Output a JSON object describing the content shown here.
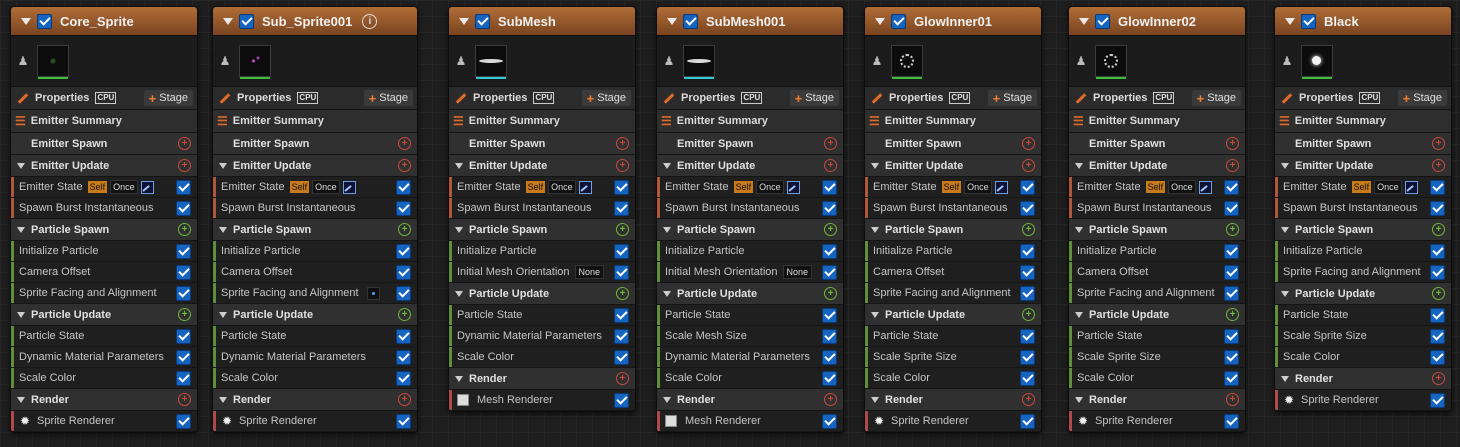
{
  "emitters": [
    {
      "name": "Core_Sprite",
      "warning": false,
      "thumb": "sprite dots",
      "props_label": "Properties",
      "cpu_label": "CPU",
      "stage_label": "Stage",
      "summary_label": "Emitter Summary",
      "sections": [
        {
          "title": "Emitter Spawn",
          "arrow": false,
          "add": "red",
          "kind": "emitter-mod",
          "modules": []
        },
        {
          "title": "Emitter Update",
          "arrow": true,
          "add": "red",
          "kind": "emitter-mod",
          "modules": [
            {
              "label": "Emitter State",
              "extra": "state",
              "self": "Self",
              "once": "Once"
            },
            {
              "label": "Spawn Burst Instantaneous"
            }
          ]
        },
        {
          "title": "Particle Spawn",
          "arrow": true,
          "add": "green",
          "kind": "spawn-mod",
          "modules": [
            {
              "label": "Initialize Particle"
            },
            {
              "label": "Camera Offset"
            },
            {
              "label": "Sprite Facing and Alignment"
            }
          ]
        },
        {
          "title": "Particle Update",
          "arrow": true,
          "add": "green",
          "kind": "update-mod",
          "modules": [
            {
              "label": "Particle State"
            },
            {
              "label": "Dynamic Material Parameters"
            },
            {
              "label": "Scale Color"
            }
          ]
        },
        {
          "title": "Render",
          "arrow": true,
          "add": "red",
          "kind": "render-mod",
          "modules": [
            {
              "label": "Sprite Renderer",
              "renderer": "sprite"
            }
          ]
        }
      ]
    },
    {
      "name": "Sub_Sprite001",
      "warning": true,
      "warning_icon": "i",
      "thumb": "sprite pink",
      "props_label": "Properties",
      "cpu_label": "CPU",
      "stage_label": "Stage",
      "summary_label": "Emitter Summary",
      "sections": [
        {
          "title": "Emitter Spawn",
          "arrow": false,
          "add": "red",
          "kind": "emitter-mod",
          "modules": []
        },
        {
          "title": "Emitter Update",
          "arrow": true,
          "add": "red",
          "kind": "emitter-mod",
          "modules": [
            {
              "label": "Emitter State",
              "extra": "state",
              "self": "Self",
              "once": "Once"
            },
            {
              "label": "Spawn Burst Instantaneous"
            }
          ]
        },
        {
          "title": "Particle Spawn",
          "arrow": true,
          "add": "green",
          "kind": "spawn-mod",
          "modules": [
            {
              "label": "Initialize Particle"
            },
            {
              "label": "Camera Offset"
            },
            {
              "label": "Sprite Facing and Alignment",
              "extra": "dot"
            }
          ]
        },
        {
          "title": "Particle Update",
          "arrow": true,
          "add": "green",
          "kind": "update-mod",
          "modules": [
            {
              "label": "Particle State"
            },
            {
              "label": "Dynamic Material Parameters"
            },
            {
              "label": "Scale Color"
            }
          ]
        },
        {
          "title": "Render",
          "arrow": true,
          "add": "red",
          "kind": "render-mod",
          "modules": [
            {
              "label": "Sprite Renderer",
              "renderer": "sprite"
            }
          ]
        }
      ]
    },
    {
      "name": "SubMesh",
      "warning": false,
      "thumb": "mesh",
      "props_label": "Properties",
      "cpu_label": "CPU",
      "stage_label": "Stage",
      "summary_label": "Emitter Summary",
      "sections": [
        {
          "title": "Emitter Spawn",
          "arrow": false,
          "add": "red",
          "kind": "emitter-mod",
          "modules": []
        },
        {
          "title": "Emitter Update",
          "arrow": true,
          "add": "red",
          "kind": "emitter-mod",
          "modules": [
            {
              "label": "Emitter State",
              "extra": "state",
              "self": "Self",
              "once": "Once"
            },
            {
              "label": "Spawn Burst Instantaneous"
            }
          ]
        },
        {
          "title": "Particle Spawn",
          "arrow": true,
          "add": "green",
          "kind": "spawn-mod",
          "modules": [
            {
              "label": "Initialize Particle"
            },
            {
              "label": "Initial Mesh Orientation",
              "extra": "none",
              "none": "None"
            }
          ]
        },
        {
          "title": "Particle Update",
          "arrow": true,
          "add": "green",
          "kind": "update-mod",
          "modules": [
            {
              "label": "Particle State"
            },
            {
              "label": "Dynamic Material Parameters"
            },
            {
              "label": "Scale Color"
            }
          ]
        },
        {
          "title": "Render",
          "arrow": true,
          "add": "red",
          "kind": "render-mod",
          "modules": [
            {
              "label": "Mesh Renderer",
              "renderer": "mesh"
            }
          ]
        }
      ]
    },
    {
      "name": "SubMesh001",
      "warning": false,
      "thumb": "mesh",
      "props_label": "Properties",
      "cpu_label": "CPU",
      "stage_label": "Stage",
      "summary_label": "Emitter Summary",
      "sections": [
        {
          "title": "Emitter Spawn",
          "arrow": false,
          "add": "red",
          "kind": "emitter-mod",
          "modules": []
        },
        {
          "title": "Emitter Update",
          "arrow": true,
          "add": "red",
          "kind": "emitter-mod",
          "modules": [
            {
              "label": "Emitter State",
              "extra": "state",
              "self": "Self",
              "once": "Once"
            },
            {
              "label": "Spawn Burst Instantaneous"
            }
          ]
        },
        {
          "title": "Particle Spawn",
          "arrow": true,
          "add": "green",
          "kind": "spawn-mod",
          "modules": [
            {
              "label": "Initialize Particle"
            },
            {
              "label": "Initial Mesh Orientation",
              "extra": "none",
              "none": "None"
            }
          ]
        },
        {
          "title": "Particle Update",
          "arrow": true,
          "add": "green",
          "kind": "update-mod",
          "modules": [
            {
              "label": "Particle State"
            },
            {
              "label": "Scale Mesh Size"
            },
            {
              "label": "Dynamic Material Parameters"
            },
            {
              "label": "Scale Color"
            }
          ]
        },
        {
          "title": "Render",
          "arrow": true,
          "add": "red",
          "kind": "render-mod",
          "modules": [
            {
              "label": "Mesh Renderer",
              "renderer": "mesh"
            }
          ]
        }
      ]
    },
    {
      "name": "GlowInner01",
      "warning": false,
      "thumb": "sprite ring",
      "props_label": "Properties",
      "cpu_label": "CPU",
      "stage_label": "Stage",
      "summary_label": "Emitter Summary",
      "sections": [
        {
          "title": "Emitter Spawn",
          "arrow": false,
          "add": "red",
          "kind": "emitter-mod",
          "modules": []
        },
        {
          "title": "Emitter Update",
          "arrow": true,
          "add": "red",
          "kind": "emitter-mod",
          "modules": [
            {
              "label": "Emitter State",
              "extra": "state",
              "self": "Self",
              "once": "Once"
            },
            {
              "label": "Spawn Burst Instantaneous"
            }
          ]
        },
        {
          "title": "Particle Spawn",
          "arrow": true,
          "add": "green",
          "kind": "spawn-mod",
          "modules": [
            {
              "label": "Initialize Particle"
            },
            {
              "label": "Camera Offset"
            },
            {
              "label": "Sprite Facing and Alignment"
            }
          ]
        },
        {
          "title": "Particle Update",
          "arrow": true,
          "add": "green",
          "kind": "update-mod",
          "modules": [
            {
              "label": "Particle State"
            },
            {
              "label": "Scale Sprite Size"
            },
            {
              "label": "Scale Color"
            }
          ]
        },
        {
          "title": "Render",
          "arrow": true,
          "add": "red",
          "kind": "render-mod",
          "modules": [
            {
              "label": "Sprite Renderer",
              "renderer": "sprite"
            }
          ]
        }
      ]
    },
    {
      "name": "GlowInner02",
      "warning": false,
      "thumb": "sprite ring",
      "props_label": "Properties",
      "cpu_label": "CPU",
      "stage_label": "Stage",
      "summary_label": "Emitter Summary",
      "sections": [
        {
          "title": "Emitter Spawn",
          "arrow": false,
          "add": "red",
          "kind": "emitter-mod",
          "modules": []
        },
        {
          "title": "Emitter Update",
          "arrow": true,
          "add": "red",
          "kind": "emitter-mod",
          "modules": [
            {
              "label": "Emitter State",
              "extra": "state",
              "self": "Self",
              "once": "Once"
            },
            {
              "label": "Spawn Burst Instantaneous"
            }
          ]
        },
        {
          "title": "Particle Spawn",
          "arrow": true,
          "add": "green",
          "kind": "spawn-mod",
          "modules": [
            {
              "label": "Initialize Particle"
            },
            {
              "label": "Camera Offset"
            },
            {
              "label": "Sprite Facing and Alignment"
            }
          ]
        },
        {
          "title": "Particle Update",
          "arrow": true,
          "add": "green",
          "kind": "update-mod",
          "modules": [
            {
              "label": "Particle State"
            },
            {
              "label": "Scale Sprite Size"
            },
            {
              "label": "Scale Color"
            }
          ]
        },
        {
          "title": "Render",
          "arrow": true,
          "add": "red",
          "kind": "render-mod",
          "modules": [
            {
              "label": "Sprite Renderer",
              "renderer": "sprite"
            }
          ]
        }
      ]
    },
    {
      "name": "Black",
      "warning": false,
      "thumb": "sprite dot",
      "props_label": "Properties",
      "cpu_label": "CPU",
      "stage_label": "Stage",
      "summary_label": "Emitter Summary",
      "sections": [
        {
          "title": "Emitter Spawn",
          "arrow": false,
          "add": "red",
          "kind": "emitter-mod",
          "modules": []
        },
        {
          "title": "Emitter Update",
          "arrow": true,
          "add": "red",
          "kind": "emitter-mod",
          "modules": [
            {
              "label": "Emitter State",
              "extra": "state",
              "self": "Self",
              "once": "Once"
            },
            {
              "label": "Spawn Burst Instantaneous"
            }
          ]
        },
        {
          "title": "Particle Spawn",
          "arrow": true,
          "add": "green",
          "kind": "spawn-mod",
          "modules": [
            {
              "label": "Initialize Particle"
            },
            {
              "label": "Sprite Facing and Alignment"
            }
          ]
        },
        {
          "title": "Particle Update",
          "arrow": true,
          "add": "green",
          "kind": "update-mod",
          "modules": [
            {
              "label": "Particle State"
            },
            {
              "label": "Scale Sprite Size"
            },
            {
              "label": "Scale Color"
            }
          ]
        },
        {
          "title": "Render",
          "arrow": true,
          "add": "red",
          "kind": "render-mod",
          "modules": [
            {
              "label": "Sprite Renderer",
              "renderer": "sprite"
            }
          ]
        }
      ]
    }
  ]
}
